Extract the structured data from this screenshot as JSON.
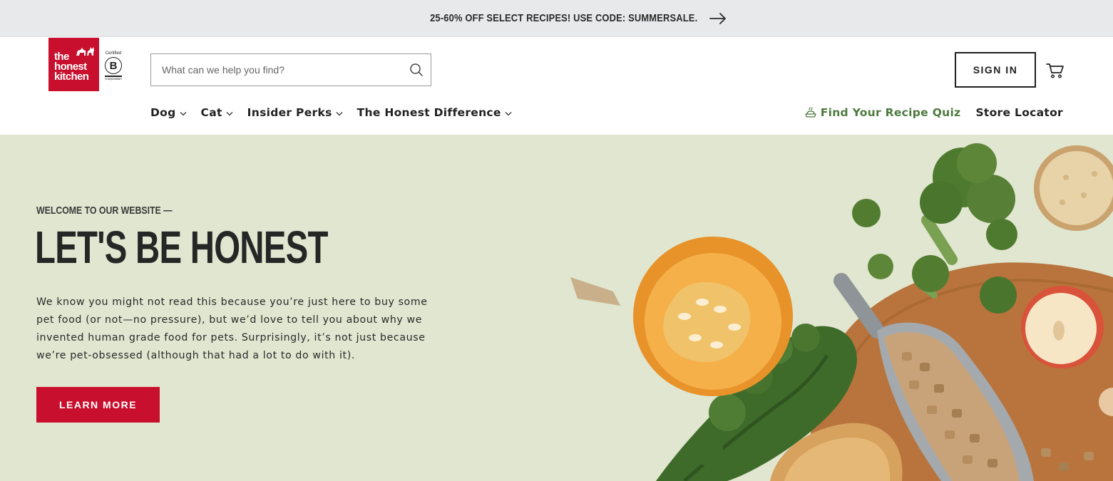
{
  "promo": {
    "text": "25-60% OFF SELECT RECIPES! USE CODE: SUMMERSALE.",
    "arrow_icon": "arrow-right-icon"
  },
  "header": {
    "logo": {
      "line1": "the",
      "line2": "honest",
      "line3": "kitchen"
    },
    "bcorp": {
      "certified": "Certified",
      "letter": "B",
      "corporation": "Corporation"
    },
    "search": {
      "placeholder": "What can we help you find?",
      "value": "",
      "icon": "search-icon"
    },
    "sign_in_label": "SIGN IN",
    "cart_icon": "cart-icon"
  },
  "nav": {
    "items": [
      {
        "label": "Dog"
      },
      {
        "label": "Cat"
      },
      {
        "label": "Insider Perks"
      },
      {
        "label": "The Honest Difference"
      }
    ],
    "quiz_label": "Find Your Recipe Quiz",
    "quiz_icon": "food-bowl-icon",
    "store_locator_label": "Store Locator"
  },
  "hero": {
    "eyebrow": "WELCOME TO OUR WEBSITE —",
    "headline": "LET'S BE HONEST",
    "body": "We know you might not read this because you’re just here to buy some pet food (or not—no pressure), but we’d love to tell you about why we invented human grade food for pets. Surprisingly, it’s not just because we’re pet-obsessed (although that had a lot to do with it).",
    "cta_label": "LEARN MORE"
  },
  "colors": {
    "brand_red": "#c8102e",
    "hero_bg": "#e0e6cf",
    "promo_bg": "#e8e9ea",
    "quiz_green": "#4d7a3e"
  }
}
